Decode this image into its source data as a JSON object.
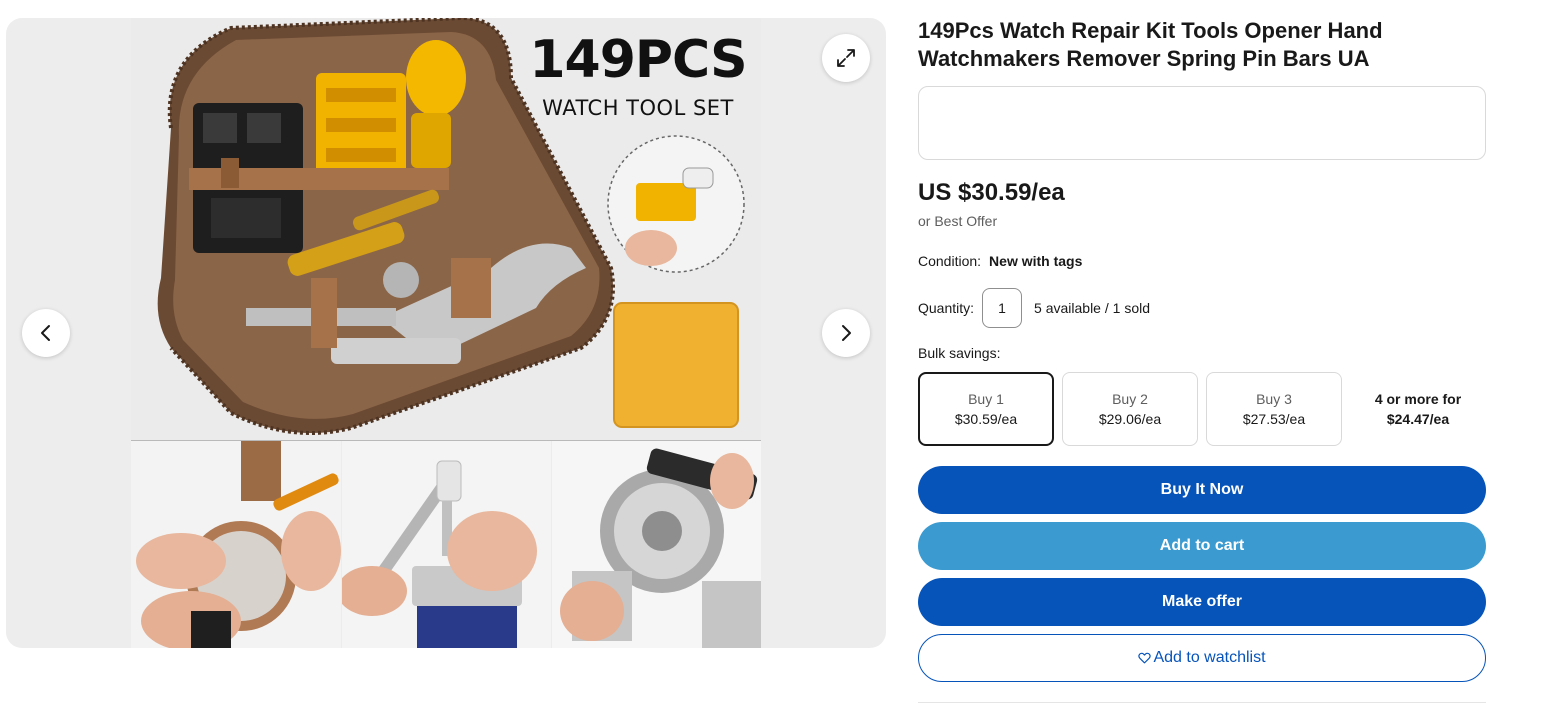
{
  "gallery": {
    "hero_title": "149PCS",
    "hero_subtitle": "WATCH TOOL SET",
    "icons": {
      "expand": "expand-icon",
      "prev": "chevron-left-icon",
      "next": "chevron-right-icon"
    }
  },
  "listing": {
    "title": "149Pcs Watch Repair Kit Tools Opener Hand Watchmakers Remover Spring Pin Bars UA",
    "price": "US $30.59/ea",
    "best_offer": "or Best Offer",
    "condition_label": "Condition:",
    "condition_value": "New with tags",
    "quantity_label": "Quantity:",
    "quantity_value": "1",
    "availability": "5 available / 1 sold",
    "bulk_label": "Bulk savings:",
    "bulk_tiers": [
      {
        "qty": "Buy 1",
        "price": "$30.59/ea",
        "selected": true
      },
      {
        "qty": "Buy 2",
        "price": "$29.06/ea",
        "selected": false
      },
      {
        "qty": "Buy 3",
        "price": "$27.53/ea",
        "selected": false
      },
      {
        "qty": "4 or more for",
        "price": "$24.47/ea",
        "selected": false
      }
    ]
  },
  "actions": {
    "buy_now": "Buy It Now",
    "add_to_cart": "Add to cart",
    "make_offer": "Make offer",
    "watchlist": "Add to watchlist",
    "watchlist_icon": "heart-icon"
  },
  "colors": {
    "primary_blue": "#0654ba",
    "cart_blue": "#3b9bd1",
    "text": "#191919",
    "muted": "#5e5e5e",
    "gallery_bg": "#ededed"
  }
}
